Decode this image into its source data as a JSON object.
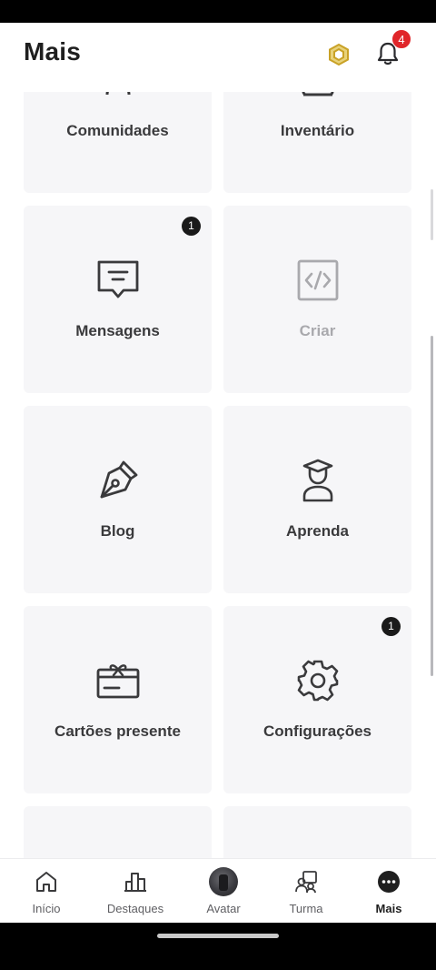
{
  "header": {
    "title": "Mais",
    "robux_icon": "robux-hexagon-icon",
    "bell_icon": "bell-icon",
    "notification_count": "4"
  },
  "grid": {
    "tiles": [
      {
        "label": "Comunidades",
        "icon": "communities-icon",
        "badge": ""
      },
      {
        "label": "Inventário",
        "icon": "inventory-icon",
        "badge": ""
      },
      {
        "label": "Mensagens",
        "icon": "message-icon",
        "badge": "1"
      },
      {
        "label": "Criar",
        "icon": "code-icon",
        "badge": ""
      },
      {
        "label": "Blog",
        "icon": "pen-icon",
        "badge": ""
      },
      {
        "label": "Aprenda",
        "icon": "graduate-icon",
        "badge": ""
      },
      {
        "label": "Cartões presente",
        "icon": "gift-card-icon",
        "badge": ""
      },
      {
        "label": "Configurações",
        "icon": "gear-icon",
        "badge": "1"
      }
    ]
  },
  "tabbar": {
    "items": [
      {
        "label": "Início",
        "icon": "home-icon"
      },
      {
        "label": "Destaques",
        "icon": "chart-icon"
      },
      {
        "label": "Avatar",
        "icon": "avatar-icon"
      },
      {
        "label": "Turma",
        "icon": "friends-icon"
      },
      {
        "label": "Mais",
        "icon": "more-icon"
      }
    ],
    "active": "Mais"
  },
  "colors": {
    "badge_red": "#e0262a",
    "tile_bg": "#f6f6f8",
    "robux_gold": "#c9a227"
  }
}
